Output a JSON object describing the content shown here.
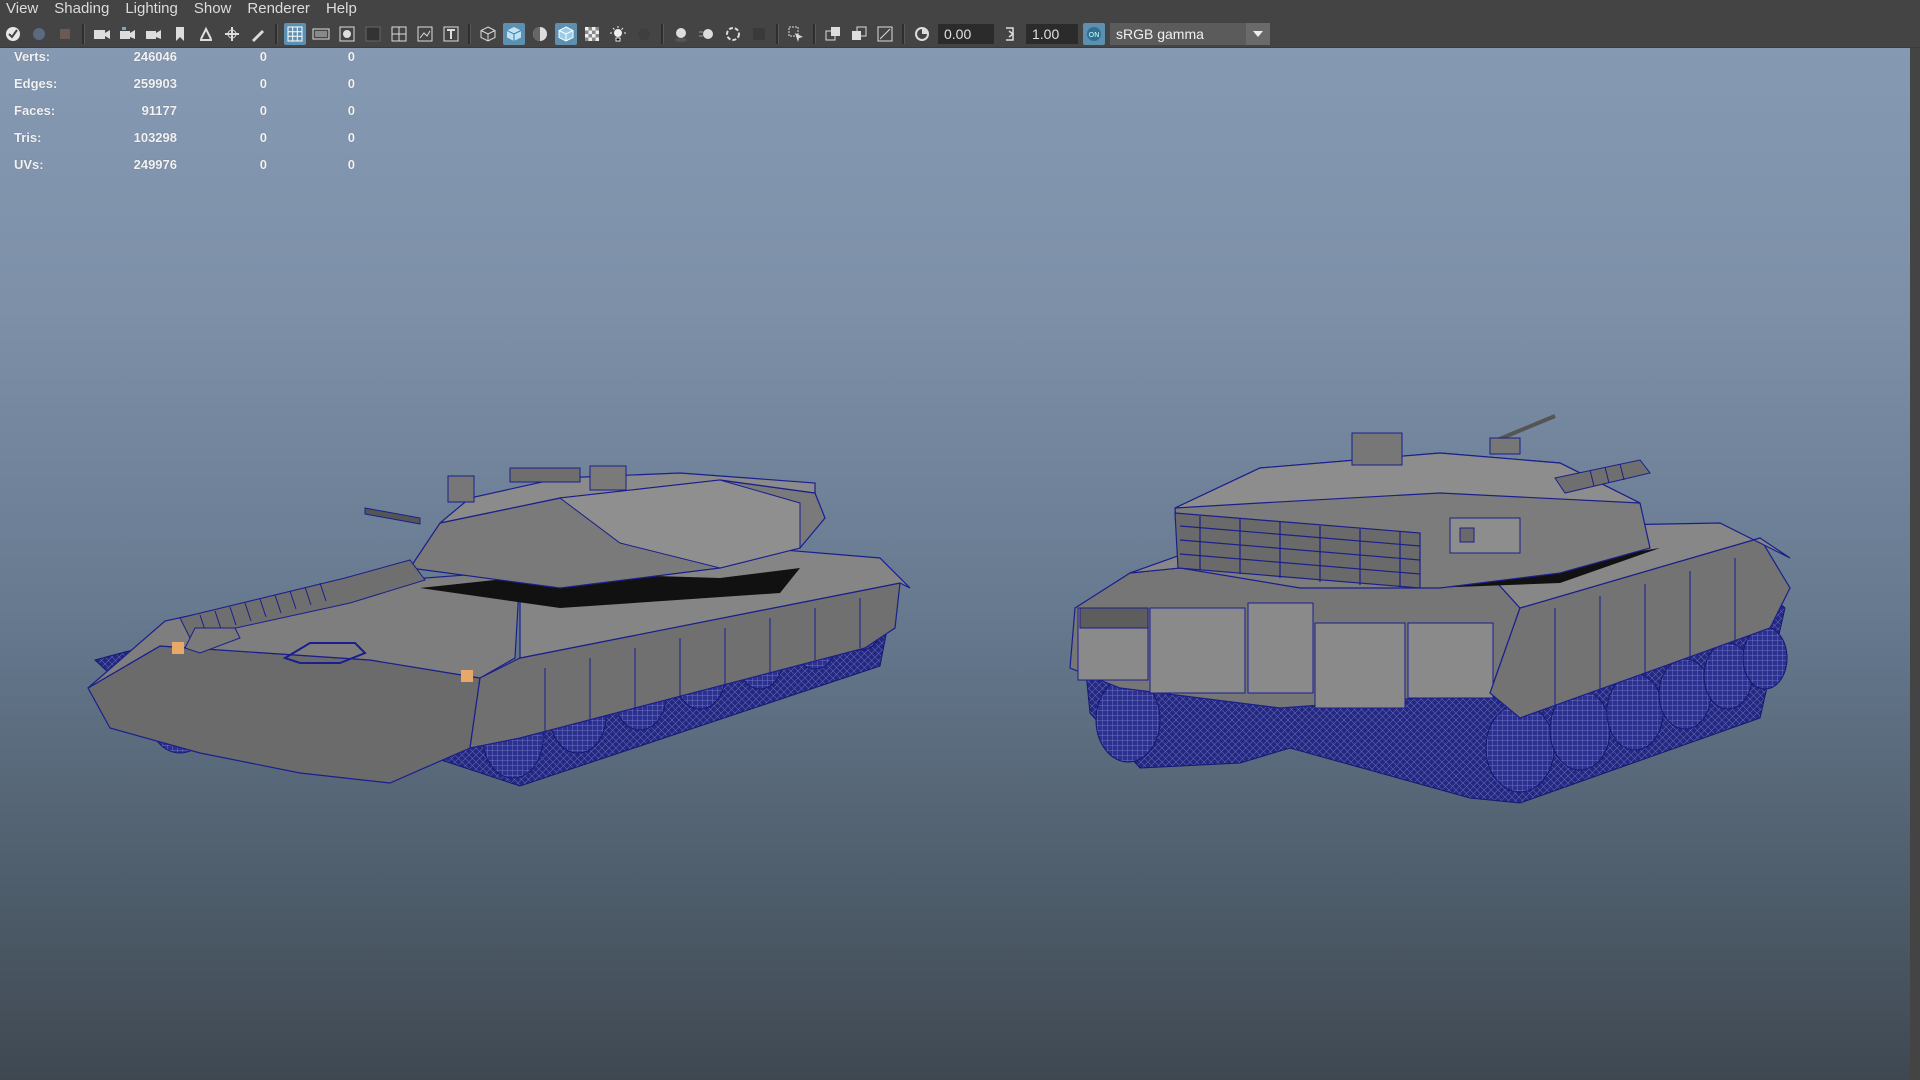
{
  "menu": [
    "View",
    "Shading",
    "Lighting",
    "Show",
    "Renderer",
    "Help"
  ],
  "toolbar": {
    "exposure": "0.00",
    "gamma": "1.00",
    "color_space": "sRGB gamma",
    "icons": [
      "select-camera-icon",
      "camera-attributes-icon",
      "bookmark-icon",
      "image-plane-icon",
      "2d-pan-icon",
      "grease-pencil-icon",
      "grid-icon",
      "film-gate-icon",
      "resolution-gate-icon",
      "gate-mask-icon",
      "field-chart-icon",
      "safe-action-icon",
      "safe-title-icon",
      "wireframe-icon",
      "smooth-shade-icon",
      "default-material-icon",
      "wireframe-on-shaded-icon",
      "textured-icon",
      "use-all-lights-icon",
      "shadows-icon",
      "ambient-occlusion-icon",
      "motion-blur-icon",
      "anti-aliasing-icon",
      "depth-of-field-icon",
      "isolate-select-icon",
      "xray-icon",
      "xray-joints-icon",
      "backface-culling-icon",
      "exposure-icon",
      "gamma-icon",
      "color-management-icon"
    ]
  },
  "hud": {
    "rows": [
      {
        "label": "Verts:",
        "value": "246046",
        "selected": "0",
        "component": "0"
      },
      {
        "label": "Edges:",
        "value": "259903",
        "selected": "0",
        "component": "0"
      },
      {
        "label": "Faces:",
        "value": "91177",
        "selected": "0",
        "component": "0"
      },
      {
        "label": "Tris:",
        "value": "103298",
        "selected": "0",
        "component": "0"
      },
      {
        "label": "UVs:",
        "value": "249976",
        "selected": "0",
        "component": "0"
      }
    ]
  },
  "colors": {
    "menubar": "#444444",
    "active_toggle": "#5c8fb0",
    "wireframe": "#1a1f8c",
    "tank_body": "#767676"
  }
}
